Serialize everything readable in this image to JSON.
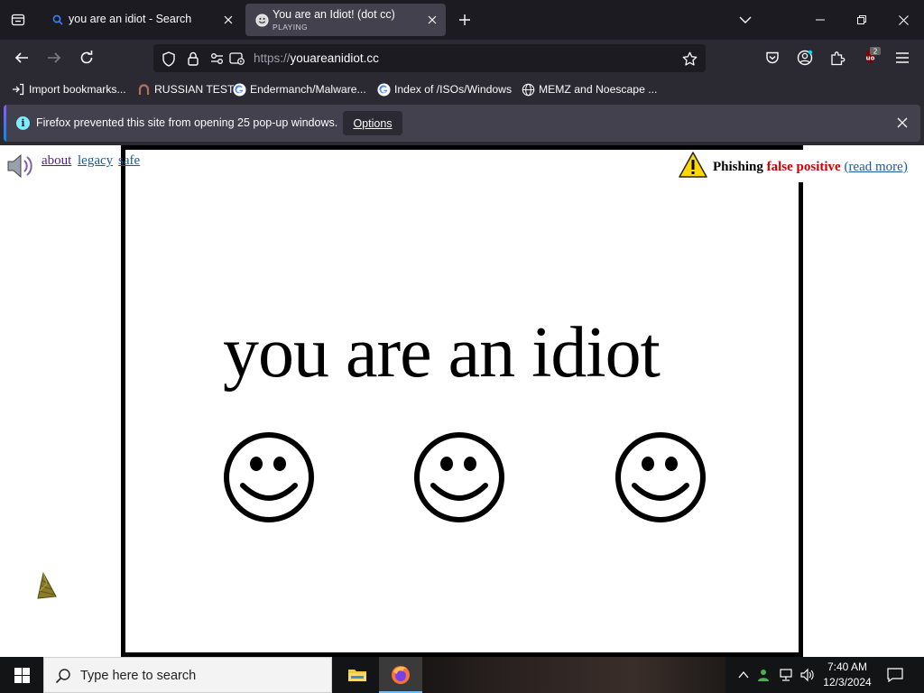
{
  "tabs": [
    {
      "title": "you are an idiot - Search",
      "subtitle": "",
      "active": false,
      "icon": "search-icon"
    },
    {
      "title": "You are an Idiot! (dot cc)",
      "subtitle": "PLAYING",
      "active": true,
      "icon": "smiley-favicon-icon"
    }
  ],
  "urlbar": {
    "scheme": "https://",
    "host": "youareanidiot.cc"
  },
  "bookmarks": [
    {
      "label": "Import bookmarks...",
      "icon": "import-icon"
    },
    {
      "label": "RUSSIAN TEST",
      "icon": "horseshoe-icon"
    },
    {
      "label": "Endermanch/Malware...",
      "icon": "google-icon"
    },
    {
      "label": "Index of /ISOs/Windows",
      "icon": "google-icon"
    },
    {
      "label": "MEMZ and Noescape ...",
      "icon": "globe-icon"
    }
  ],
  "notification": {
    "message": "Firefox prevented this site from opening 25 pop-up windows.",
    "options_label": "Options"
  },
  "extensions_badge": "2",
  "page": {
    "links": [
      "about",
      "legacy",
      "safe"
    ],
    "headline": "you are an idiot",
    "phishing": {
      "label": "Phishing",
      "flag": "false positive",
      "more": "(read more)"
    },
    "smiley_count": 3
  },
  "taskbar": {
    "search_placeholder": "Type here to search",
    "time": "7:40 AM",
    "date": "12/3/2024"
  },
  "colors": {
    "tabstrip": "#1c1b22",
    "toolbar": "#2b2a33",
    "active_tab": "#42414d",
    "notification_accent": "#80ebff",
    "phishing_red": "#cc0000",
    "link_blue": "#1a5a9c",
    "link_visited": "#551a8b"
  }
}
